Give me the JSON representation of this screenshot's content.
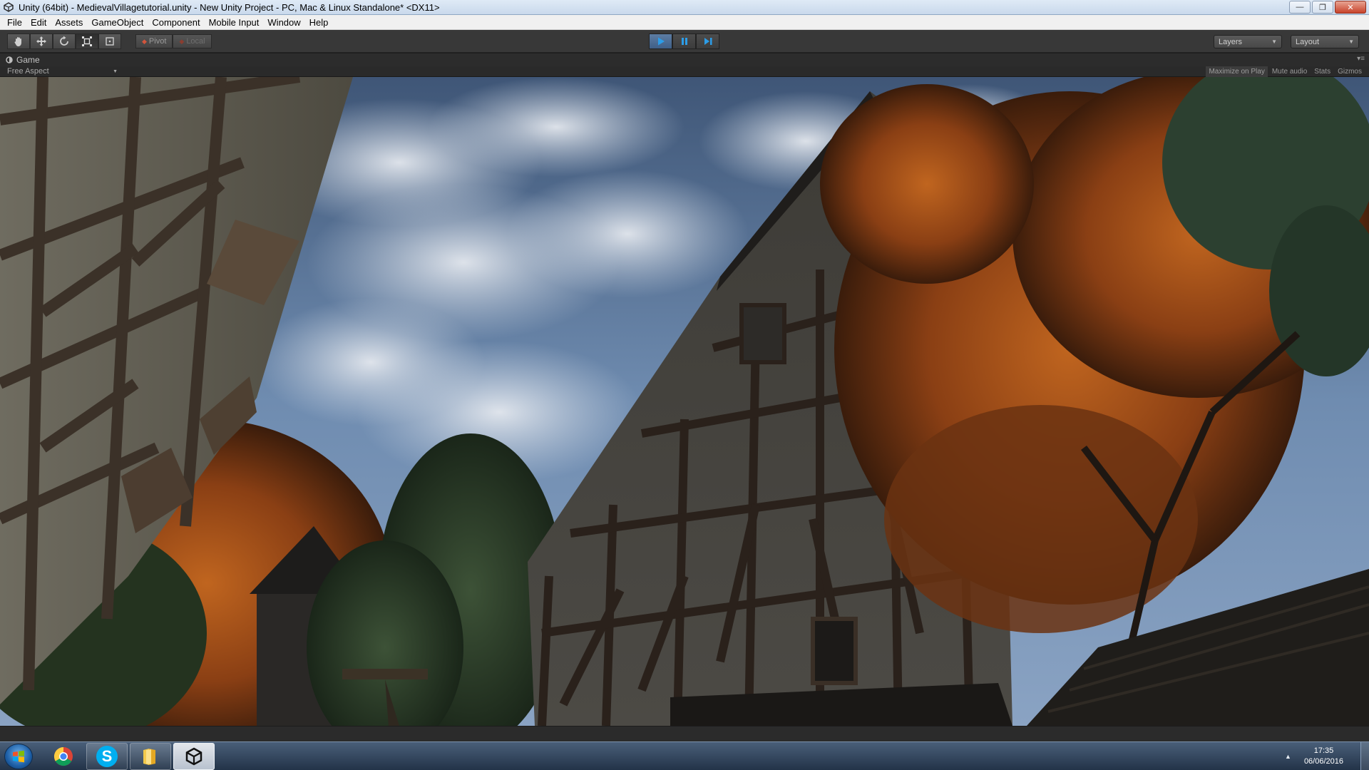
{
  "window": {
    "title": "Unity (64bit) - MedievalVillagetutorial.unity - New Unity Project - PC, Mac & Linux Standalone* <DX11>",
    "minimize_glyph": "—",
    "maximize_glyph": "❐",
    "close_glyph": "✕"
  },
  "menu": {
    "items": [
      "File",
      "Edit",
      "Assets",
      "GameObject",
      "Component",
      "Mobile Input",
      "Window",
      "Help"
    ]
  },
  "toolbar": {
    "tools": [
      {
        "name": "hand-tool",
        "icon": "hand-icon"
      },
      {
        "name": "move-tool",
        "icon": "move-icon"
      },
      {
        "name": "rotate-tool",
        "icon": "rotate-icon"
      },
      {
        "name": "scale-tool",
        "icon": "scale-icon",
        "active": true
      },
      {
        "name": "rect-tool",
        "icon": "rect-icon"
      }
    ],
    "pivot_label": "Pivot",
    "local_label": "Local",
    "play": {
      "active": true
    },
    "layers_label": "Layers",
    "layout_label": "Layout"
  },
  "game_panel": {
    "tab_label": "Game",
    "aspect_label": "Free Aspect",
    "maximize_on_play": "Maximize on Play",
    "mute_audio": "Mute audio",
    "stats": "Stats",
    "gizmos": "Gizmos"
  },
  "taskbar": {
    "apps": [
      {
        "name": "chrome",
        "icon": "chrome-icon"
      },
      {
        "name": "skype",
        "icon": "skype-icon",
        "letter": "S"
      },
      {
        "name": "file-explorer",
        "icon": "folder-icon"
      },
      {
        "name": "unity",
        "icon": "unity-icon",
        "active": true
      }
    ],
    "time": "17:35",
    "date": "06/06/2016"
  },
  "colors": {
    "unity_dark": "#383838",
    "play_blue": "#3f5f87",
    "taskbar": "#233348",
    "sky": "#6e8db3",
    "autumn_leaves": "#b0551c"
  }
}
